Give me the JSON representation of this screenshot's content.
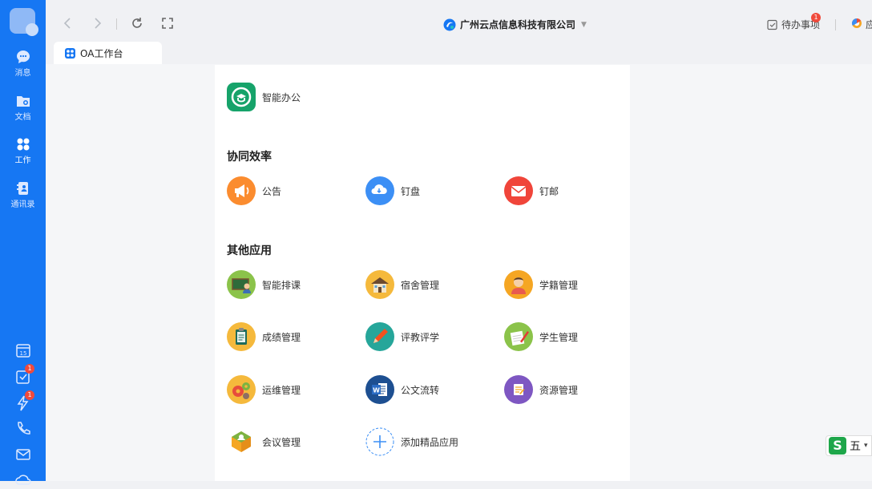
{
  "sidebar": {
    "items": [
      {
        "label": "消息",
        "icon": "chat-icon"
      },
      {
        "label": "文档",
        "icon": "folder-icon"
      },
      {
        "label": "工作",
        "icon": "grid-icon"
      },
      {
        "label": "通讯录",
        "icon": "contacts-icon"
      }
    ],
    "bottom_icons": [
      {
        "icon": "calendar-icon",
        "text": "15"
      },
      {
        "icon": "todo-check-icon",
        "badge": "1"
      },
      {
        "icon": "flash-icon",
        "badge": "1"
      },
      {
        "icon": "phone-icon"
      },
      {
        "icon": "mail-icon"
      }
    ]
  },
  "topbar": {
    "company": "广州云点信息科技有限公司",
    "todo_label": "待办事项",
    "todo_badge": "1",
    "right_partial": "应"
  },
  "tab": {
    "label": "OA工作台"
  },
  "main": {
    "top_app": {
      "label": "智能办公",
      "color": "#16a36a"
    },
    "sections": [
      {
        "title": "协同效率",
        "apps": [
          {
            "label": "公告",
            "color": "#fb8c2f"
          },
          {
            "label": "钉盘",
            "color": "#3c8ff5"
          },
          {
            "label": "钉邮",
            "color": "#f0453a"
          }
        ]
      },
      {
        "title": "其他应用",
        "apps": [
          {
            "label": "智能排课"
          },
          {
            "label": "宿舍管理"
          },
          {
            "label": "学籍管理"
          },
          {
            "label": "成绩管理"
          },
          {
            "label": "评教评学"
          },
          {
            "label": "学生管理"
          },
          {
            "label": "运维管理"
          },
          {
            "label": "公文流转"
          },
          {
            "label": "资源管理"
          },
          {
            "label": "会议管理"
          },
          {
            "label": "添加精品应用"
          }
        ]
      }
    ]
  },
  "ime": {
    "label": "五"
  }
}
